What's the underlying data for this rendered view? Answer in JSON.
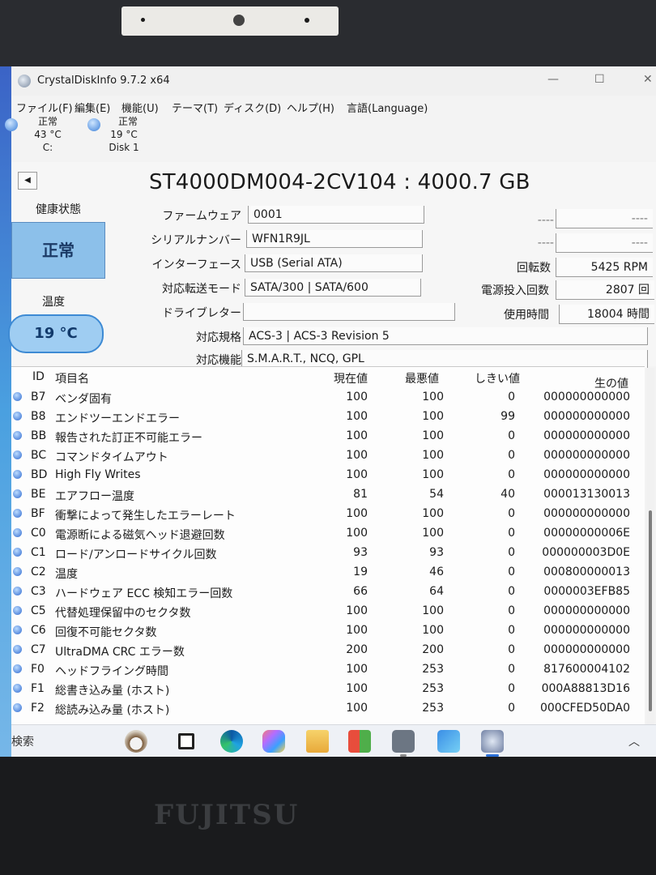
{
  "window": {
    "title": "CrystalDiskInfo 9.7.2 x64",
    "controls": [
      "—",
      "☐",
      "✕"
    ]
  },
  "menu": [
    "ファイル(F)",
    "編集(E)",
    "機能(U)",
    "テーマ(T)",
    "ディスク(D)",
    "ヘルプ(H)",
    "言語(Language)"
  ],
  "disk_tabs": [
    {
      "status": "正常",
      "temp": "43 °C",
      "name": "C:"
    },
    {
      "status": "正常",
      "temp": "19 °C",
      "name": "Disk 1"
    }
  ],
  "disk": {
    "model": "ST4000DM004-2CV104 : 4000.7 GB",
    "health_label": "健康状態",
    "health_value": "正常",
    "temp_label": "温度",
    "temp_value": "19 °C",
    "fields": [
      {
        "label": "ファームウェア",
        "value": "0001"
      },
      {
        "label": "シリアルナンバー",
        "value": "WFN1R9JL"
      },
      {
        "label": "インターフェース",
        "value": "USB (Serial ATA)"
      },
      {
        "label": "対応転送モード",
        "value": "SATA/300 | SATA/600"
      },
      {
        "label": "ドライブレター",
        "value": ""
      },
      {
        "label": "対応規格",
        "value": "ACS-3 | ACS-3 Revision 5"
      },
      {
        "label": "対応機能",
        "value": "S.M.A.R.T., NCQ, GPL"
      }
    ],
    "right_fields": [
      {
        "label": "----",
        "value": "----"
      },
      {
        "label": "----",
        "value": "----"
      },
      {
        "label": "回転数",
        "value": "5425 RPM"
      },
      {
        "label": "電源投入回数",
        "value": "2807 回"
      },
      {
        "label": "使用時間",
        "value": "18004 時間"
      }
    ]
  },
  "smart": {
    "headers": {
      "id": "ID",
      "name": "項目名",
      "current": "現在値",
      "worst": "最悪値",
      "threshold": "しきい値",
      "raw": "生の値"
    },
    "rows": [
      {
        "id": "B7",
        "name": "ベンダ固有",
        "current": "100",
        "worst": "100",
        "threshold": "0",
        "raw": "000000000000"
      },
      {
        "id": "B8",
        "name": "エンドツーエンドエラー",
        "current": "100",
        "worst": "100",
        "threshold": "99",
        "raw": "000000000000"
      },
      {
        "id": "BB",
        "name": "報告された訂正不可能エラー",
        "current": "100",
        "worst": "100",
        "threshold": "0",
        "raw": "000000000000"
      },
      {
        "id": "BC",
        "name": "コマンドタイムアウト",
        "current": "100",
        "worst": "100",
        "threshold": "0",
        "raw": "000000000000"
      },
      {
        "id": "BD",
        "name": "High Fly Writes",
        "current": "100",
        "worst": "100",
        "threshold": "0",
        "raw": "000000000000"
      },
      {
        "id": "BE",
        "name": "エアフロー温度",
        "current": "81",
        "worst": "54",
        "threshold": "40",
        "raw": "000013130013"
      },
      {
        "id": "BF",
        "name": "衝撃によって発生したエラーレート",
        "current": "100",
        "worst": "100",
        "threshold": "0",
        "raw": "000000000000"
      },
      {
        "id": "C0",
        "name": "電源断による磁気ヘッド退避回数",
        "current": "100",
        "worst": "100",
        "threshold": "0",
        "raw": "00000000006E"
      },
      {
        "id": "C1",
        "name": "ロード/アンロードサイクル回数",
        "current": "93",
        "worst": "93",
        "threshold": "0",
        "raw": "000000003D0E"
      },
      {
        "id": "C2",
        "name": "温度",
        "current": "19",
        "worst": "46",
        "threshold": "0",
        "raw": "000800000013"
      },
      {
        "id": "C3",
        "name": "ハードウェア ECC 検知エラー回数",
        "current": "66",
        "worst": "64",
        "threshold": "0",
        "raw": "0000003EFB85"
      },
      {
        "id": "C5",
        "name": "代替処理保留中のセクタ数",
        "current": "100",
        "worst": "100",
        "threshold": "0",
        "raw": "000000000000"
      },
      {
        "id": "C6",
        "name": "回復不可能セクタ数",
        "current": "100",
        "worst": "100",
        "threshold": "0",
        "raw": "000000000000"
      },
      {
        "id": "C7",
        "name": "UltraDMA CRC エラー数",
        "current": "200",
        "worst": "200",
        "threshold": "0",
        "raw": "000000000000"
      },
      {
        "id": "F0",
        "name": "ヘッドフライング時間",
        "current": "100",
        "worst": "253",
        "threshold": "0",
        "raw": "817600004102"
      },
      {
        "id": "F1",
        "name": "総書き込み量 (ホスト)",
        "current": "100",
        "worst": "253",
        "threshold": "0",
        "raw": "000A88813D16"
      },
      {
        "id": "F2",
        "name": "総読み込み量 (ホスト)",
        "current": "100",
        "worst": "253",
        "threshold": "0",
        "raw": "000CFED50DA0"
      }
    ]
  },
  "taskbar": {
    "search": "検索",
    "icons": [
      "bowl-icon",
      "task-view-icon",
      "edge-icon",
      "copilot-icon",
      "folder-icon",
      "store-icon",
      "camera-icon",
      "photos-icon",
      "crystaldiskinfo-icon"
    ]
  },
  "laptop": {
    "brand": "FUJITSU"
  },
  "colors": {
    "health_good": "#8cc0ea",
    "accent": "#2a5bd7"
  }
}
